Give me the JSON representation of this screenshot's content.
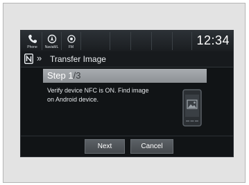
{
  "statusbar": {
    "phone_label": "Phone",
    "navi_label": "NaviaML",
    "fm_label": "FM",
    "clock": "12:34"
  },
  "header": {
    "title": "Transfer Image"
  },
  "step": {
    "current": "Step 1",
    "total": "/3"
  },
  "instructions": {
    "line1": "Verify device NFC is ON. Find image",
    "line2": "on Android device."
  },
  "buttons": {
    "next_label": "Next",
    "cancel_label": "Cancel"
  },
  "icons": {
    "phone": "phone-icon",
    "navi": "navi-icon",
    "fm": "fm-icon",
    "nfc": "nfc-icon",
    "breadcrumb": "double-chevron-right-icon",
    "device": "smartphone-image-icon"
  }
}
